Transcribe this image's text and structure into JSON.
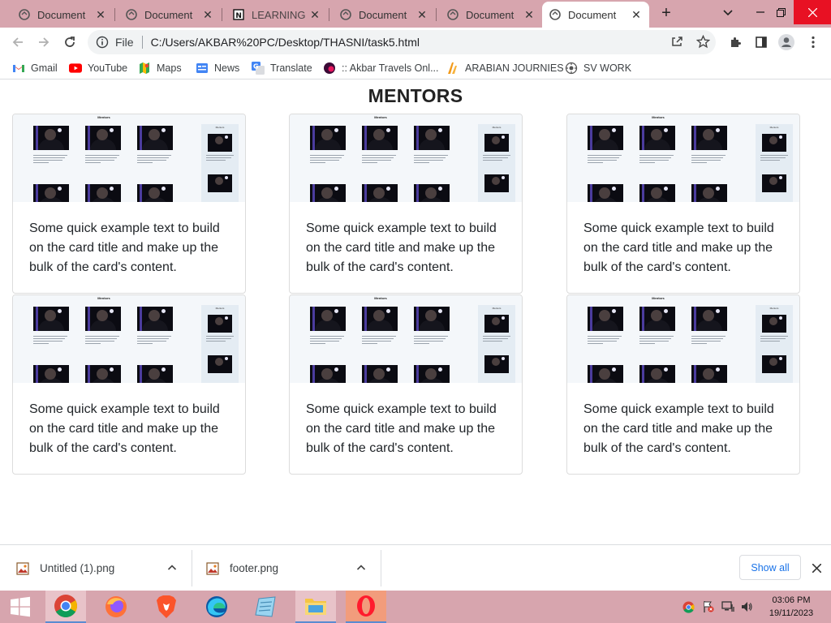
{
  "browser": {
    "tabs": [
      {
        "title": "Document"
      },
      {
        "title": "Document"
      },
      {
        "title": "LEARNING FI"
      },
      {
        "title": "Document"
      },
      {
        "title": "Document"
      },
      {
        "title": "Document"
      }
    ],
    "omnibox": {
      "scheme_label": "File",
      "url": "C:/Users/AKBAR%20PC/Desktop/THASNI/task5.html"
    },
    "bookmarks": [
      {
        "label": "Gmail",
        "icon": "gmail-icon"
      },
      {
        "label": "YouTube",
        "icon": "youtube-icon"
      },
      {
        "label": "Maps",
        "icon": "maps-icon"
      },
      {
        "label": "News",
        "icon": "news-icon"
      },
      {
        "label": "Translate",
        "icon": "translate-icon"
      },
      {
        "label": ":: Akbar Travels Onl...",
        "icon": "akbar-travels-icon"
      },
      {
        "label": "ARABIAN JOURNIES",
        "icon": "arabian-journies-icon"
      },
      {
        "label": "SV WORK",
        "icon": "sv-work-icon"
      }
    ]
  },
  "page": {
    "heading": "MENTORS",
    "thumbnail_heading": "Mentors",
    "cards": [
      {
        "text": "Some quick example text to build on the card title and make up the bulk of the card's content."
      },
      {
        "text": "Some quick example text to build on the card title and make up the bulk of the card's content."
      },
      {
        "text": "Some quick example text to build on the card title and make up the bulk of the card's content."
      },
      {
        "text": "Some quick example text to build on the card title and make up the bulk of the card's content."
      },
      {
        "text": "Some quick example text to build on the card title and make up the bulk of the card's content."
      },
      {
        "text": "Some quick example text to build on the card title and make up the bulk of the card's content."
      }
    ]
  },
  "downloads": {
    "items": [
      {
        "name": "Untitled (1).png"
      },
      {
        "name": "footer.png"
      }
    ],
    "show_all_label": "Show all"
  },
  "taskbar": {
    "apps": [
      "start-icon",
      "chrome-icon",
      "firefox-icon",
      "brave-icon",
      "edge-icon",
      "notepad-icon",
      "file-explorer-icon",
      "opera-icon"
    ],
    "clock": {
      "time": "03:06 PM",
      "date": "19/11/2023"
    }
  },
  "colors": {
    "titlebar": "#d7a5ae",
    "link": "#1a73e8",
    "card_text": "#212529",
    "close_button": "#e81123"
  }
}
